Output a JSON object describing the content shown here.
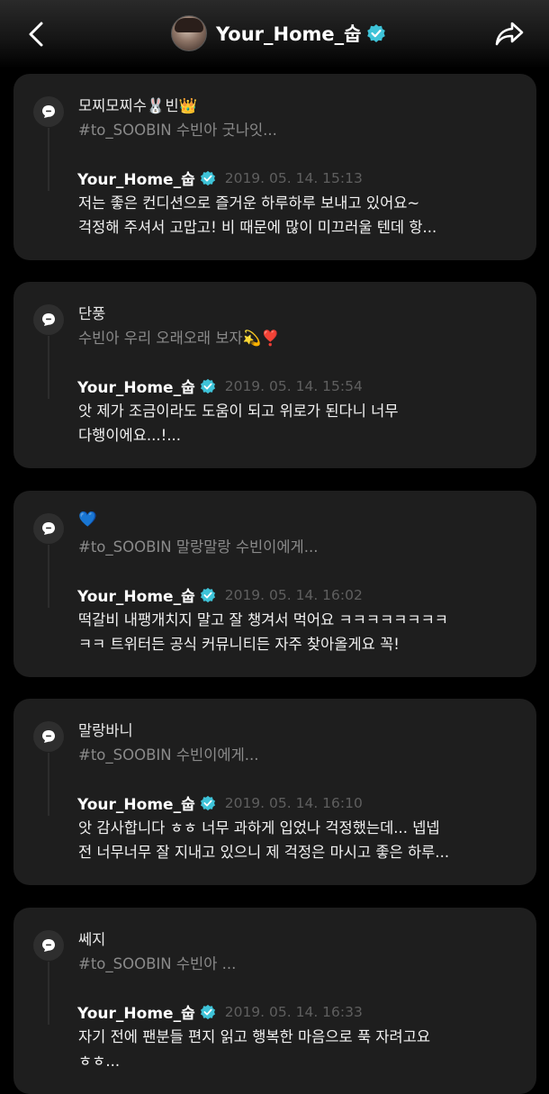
{
  "header": {
    "title": "Your_Home_숩"
  },
  "colors": {
    "background": "#000000",
    "card": "#1e1e1e",
    "verified_badge": "#3ec3d8",
    "muted_text": "#8a8a8a",
    "timestamp": "#5f5f5f"
  },
  "cards": [
    {
      "fan_name": "모찌모찌수🐰빈👑",
      "fan_message": "#to_SOOBIN 수빈아 굿나잇...",
      "reply_name": "Your_Home_숩",
      "reply_time": "2019. 05. 14. 15:13",
      "reply_lines": [
        "저는 좋은 컨디션으로 즐거운 하루하루 보내고 있어요~",
        "걱정해 주셔서 고맙고! 비 때문에 많이 미끄러울 텐데 항..."
      ]
    },
    {
      "fan_name": "단풍",
      "fan_message": "수빈아 우리 오래오래 보자💫❣️",
      "reply_name": "Your_Home_숩",
      "reply_time": "2019. 05. 14. 15:54",
      "reply_lines": [
        "앗 제가 조금이라도 도움이 되고 위로가 된다니 너무",
        "다행이에요...!..."
      ]
    },
    {
      "fan_name": "💙",
      "fan_message": "#to_SOOBIN 말랑말랑 수빈이에게...",
      "reply_name": "Your_Home_숩",
      "reply_time": "2019. 05. 14. 16:02",
      "reply_lines": [
        "떡갈비 내팽개치지 말고 잘 챙겨서 먹어요 ㅋㅋㅋㅋㅋㅋㅋㅋ",
        "ㅋㅋ 트위터든 공식 커뮤니티든 자주 찾아올게요 꼭!"
      ]
    },
    {
      "fan_name": "말랑바니",
      "fan_message": "#to_SOOBIN 수빈이에게...",
      "reply_name": "Your_Home_숩",
      "reply_time": "2019. 05. 14. 16:10",
      "reply_lines": [
        "앗 감사합니다 ㅎㅎ 너무 과하게 입었나 걱정했는데... 넵넵",
        "전 너무너무 잘 지내고 있으니 제 걱정은 마시고 좋은 하루..."
      ]
    },
    {
      "fan_name": "쎄지",
      "fan_message": "#to_SOOBIN 수빈아 ...",
      "reply_name": "Your_Home_숩",
      "reply_time": "2019. 05. 14. 16:33",
      "reply_lines": [
        "자기 전에 팬분들 편지 읽고 행복한 마음으로 푹 자려고요",
        "ㅎㅎ..."
      ]
    }
  ],
  "icons": {
    "back": "chevron-left-icon",
    "share": "share-arrow-icon",
    "verified": "verified-badge-icon",
    "comment": "comment-bubble-icon"
  }
}
